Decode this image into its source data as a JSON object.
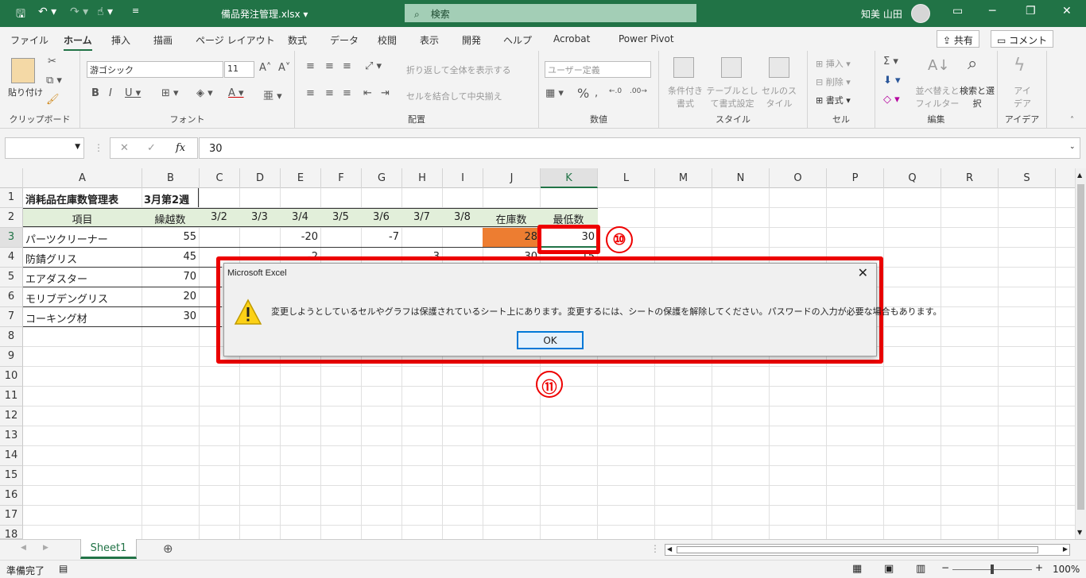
{
  "title_bar": {
    "file_name": "備品発注管理.xlsx ▾",
    "search_placeholder": "検索",
    "user_name": "知美 山田"
  },
  "menu_tabs": [
    "ファイル",
    "ホーム",
    "挿入",
    "描画",
    "ページ レイアウト",
    "数式",
    "データ",
    "校閲",
    "表示",
    "開発",
    "ヘルプ",
    "Acrobat",
    "Power Pivot"
  ],
  "share_label": "共有",
  "comment_label": "コメント",
  "ribbon": {
    "clipboard": {
      "paste": "貼り付け",
      "label": "クリップボード"
    },
    "font": {
      "family": "游ゴシック",
      "size": "11",
      "label": "フォント"
    },
    "alignment": {
      "wrap": "折り返して全体を表示する",
      "merge": "セルを結合して中央揃え",
      "label": "配置"
    },
    "number": {
      "format": "ユーザー定義",
      "label": "数値"
    },
    "styles": {
      "conditional": "条件付き書式",
      "table": "テーブルとして書式設定",
      "cell": "セルのスタイル",
      "label": "スタイル"
    },
    "cells": {
      "insert": "挿入",
      "delete": "削除",
      "format": "書式",
      "label": "セル"
    },
    "editing": {
      "sort": "並べ替えとフィルター",
      "find": "検索と選択",
      "label": "編集"
    },
    "ideas": {
      "name": "アイデア",
      "label": "アイデア"
    }
  },
  "formula_bar": {
    "fx": "fx",
    "value": "30"
  },
  "columns": [
    "A",
    "B",
    "C",
    "D",
    "E",
    "F",
    "G",
    "H",
    "I",
    "J",
    "K",
    "L",
    "M",
    "N",
    "O",
    "P",
    "Q",
    "R",
    "S"
  ],
  "rows": [
    "1",
    "2",
    "3",
    "4",
    "5",
    "6",
    "7",
    "8",
    "9",
    "10",
    "11",
    "12",
    "13",
    "14",
    "15",
    "16",
    "17",
    "18"
  ],
  "sheet": {
    "title": "消耗品在庫数管理表",
    "week": "3月第2週",
    "headers": [
      "項目",
      "繰越数",
      "3/2",
      "3/3",
      "3/4",
      "3/5",
      "3/6",
      "3/7",
      "3/8",
      "在庫数",
      "最低数"
    ],
    "items": [
      {
        "name": "パーツクリーナー",
        "carry": "55",
        "e": "-20",
        "g": "-7",
        "stock": "28",
        "min": "30"
      },
      {
        "name": "防錆グリス",
        "carry": "45",
        "e": "-2",
        "h": "-3",
        "stock": "30",
        "min": "15"
      },
      {
        "name": "エアダスター",
        "carry": "70"
      },
      {
        "name": "モリブデングリス",
        "carry": "20"
      },
      {
        "name": "コーキング材",
        "carry": "30"
      }
    ]
  },
  "sheet_tabs": [
    "Sheet1"
  ],
  "status": {
    "ready": "準備完了",
    "zoom": "100%"
  },
  "dialog": {
    "title": "Microsoft Excel",
    "message": "変更しようとしているセルやグラフは保護されているシート上にあります。変更するには、シートの保護を解除してください。パスワードの入力が必要な場合もあります。",
    "ok": "OK"
  },
  "annotations": {
    "step10": "⑩",
    "step11": "⑪"
  },
  "colors": {
    "excel_green": "#217346",
    "highlight_orange": "#ed7d31",
    "header_fill": "#e2efda",
    "annotation_red": "#ee0000"
  }
}
